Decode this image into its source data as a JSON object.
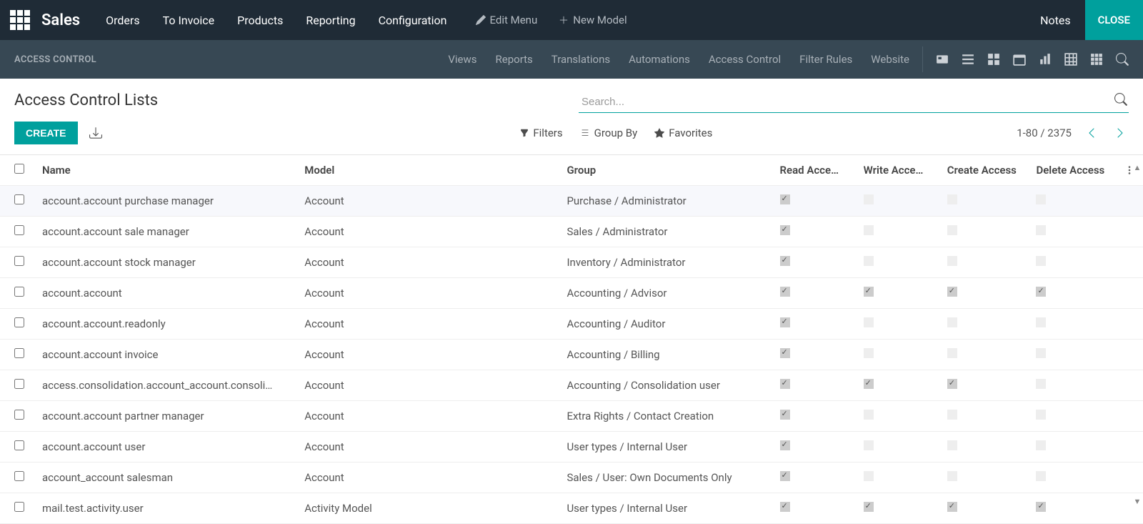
{
  "topbar": {
    "brand": "Sales",
    "nav": [
      "Orders",
      "To Invoice",
      "Products",
      "Reporting",
      "Configuration"
    ],
    "edit_menu": "Edit Menu",
    "new_model": "New Model",
    "notes": "Notes",
    "close": "CLOSE"
  },
  "subbar": {
    "title": "ACCESS CONTROL",
    "nav": [
      "Views",
      "Reports",
      "Translations",
      "Automations",
      "Access Control",
      "Filter Rules",
      "Website"
    ]
  },
  "page": {
    "title": "Access Control Lists",
    "search_placeholder": "Search...",
    "create": "CREATE",
    "filters": "Filters",
    "group_by": "Group By",
    "favorites": "Favorites",
    "pager": "1-80 / 2375"
  },
  "columns": {
    "name": "Name",
    "model": "Model",
    "group": "Group",
    "read": "Read Acce…",
    "write": "Write Acce…",
    "create": "Create Access",
    "delete": "Delete Access"
  },
  "rows": [
    {
      "name": "account.account purchase manager",
      "model": "Account",
      "group": "Purchase / Administrator",
      "read": true,
      "write": false,
      "create": false,
      "delete": false,
      "highlight": true
    },
    {
      "name": "account.account sale manager",
      "model": "Account",
      "group": "Sales / Administrator",
      "read": true,
      "write": false,
      "create": false,
      "delete": false
    },
    {
      "name": "account.account stock manager",
      "model": "Account",
      "group": "Inventory / Administrator",
      "read": true,
      "write": false,
      "create": false,
      "delete": false
    },
    {
      "name": "account.account",
      "model": "Account",
      "group": "Accounting / Advisor",
      "read": true,
      "write": true,
      "create": true,
      "delete": true
    },
    {
      "name": "account.account.readonly",
      "model": "Account",
      "group": "Accounting / Auditor",
      "read": true,
      "write": false,
      "create": false,
      "delete": false
    },
    {
      "name": "account.account invoice",
      "model": "Account",
      "group": "Accounting / Billing",
      "read": true,
      "write": false,
      "create": false,
      "delete": false
    },
    {
      "name": "access.consolidation.account_account.consoli…",
      "model": "Account",
      "group": "Accounting / Consolidation user",
      "read": true,
      "write": true,
      "create": true,
      "delete": false
    },
    {
      "name": "account.account partner manager",
      "model": "Account",
      "group": "Extra Rights / Contact Creation",
      "read": true,
      "write": false,
      "create": false,
      "delete": false
    },
    {
      "name": "account.account user",
      "model": "Account",
      "group": "User types / Internal User",
      "read": true,
      "write": false,
      "create": false,
      "delete": false
    },
    {
      "name": "account_account salesman",
      "model": "Account",
      "group": "Sales / User: Own Documents Only",
      "read": true,
      "write": false,
      "create": false,
      "delete": false
    },
    {
      "name": "mail.test.activity.user",
      "model": "Activity Model",
      "group": "User types / Internal User",
      "read": true,
      "write": true,
      "create": true,
      "delete": true
    }
  ]
}
